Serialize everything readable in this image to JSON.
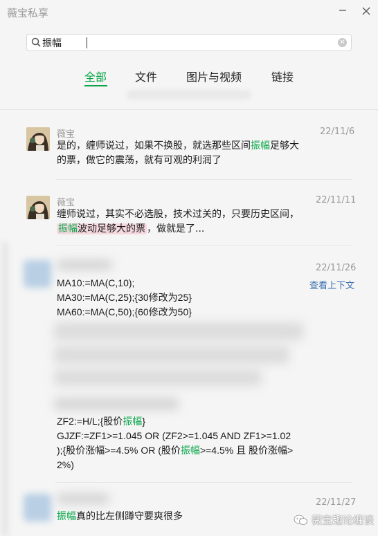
{
  "window": {
    "title": "薇宝私享"
  },
  "search": {
    "query": "振幅"
  },
  "tabs": [
    {
      "label": "全部",
      "active": true
    },
    {
      "label": "文件",
      "active": false
    },
    {
      "label": "图片与视频",
      "active": false
    },
    {
      "label": "链接",
      "active": false
    }
  ],
  "results": [
    {
      "sender": "薇宝",
      "date": "22/11/6",
      "text": {
        "a": "是的，缠师说过，如果不换股，就选那些区间",
        "hl": "振幅",
        "b": "足够大",
        "c": "的票，做它的震荡，就有可观的利润了"
      }
    },
    {
      "sender": "薇宝",
      "date": "22/11/11",
      "text": {
        "a": "缠师说过，其实不必选股，技术过关的，只要历史区间，",
        "hl": "振幅",
        "b": "波动足够大的票",
        "c": "，做就是了..."
      }
    },
    {
      "date": "22/11/26",
      "context_link": "查看上下文",
      "code_lines": [
        "MA10:=MA(C,10);",
        "MA30:=MA(C,25);{30修改为25}",
        "MA60:=MA(C,50);{60修改为50}"
      ],
      "formula": {
        "l1a": "ZF2:=H/L;{股价",
        "l1hl": "振幅",
        "l1b": "}",
        "l2": "GJZF:=ZF1>=1.045 OR (ZF2>=1.045 AND ZF1>=1.02",
        "l3a": ");{股价涨幅>=4.5% OR (股价",
        "l3hl": "振幅",
        "l3b": ">=4.5% 且 股价涨幅>",
        "l4": "2%)"
      }
    },
    {
      "date": "22/11/27",
      "text": {
        "hl": "振幅",
        "b": "真的比左侧蹲守要爽很多"
      }
    }
  ],
  "watermark": {
    "text": "薇宝趣论缠谈"
  },
  "icons": [
    "search-icon",
    "clear-icon",
    "minimize-icon",
    "close-icon",
    "watermark-icon"
  ],
  "colors": {
    "accent": "#07a548",
    "highlight_bg": "#f6d9e0",
    "link": "#3a6fb0"
  }
}
